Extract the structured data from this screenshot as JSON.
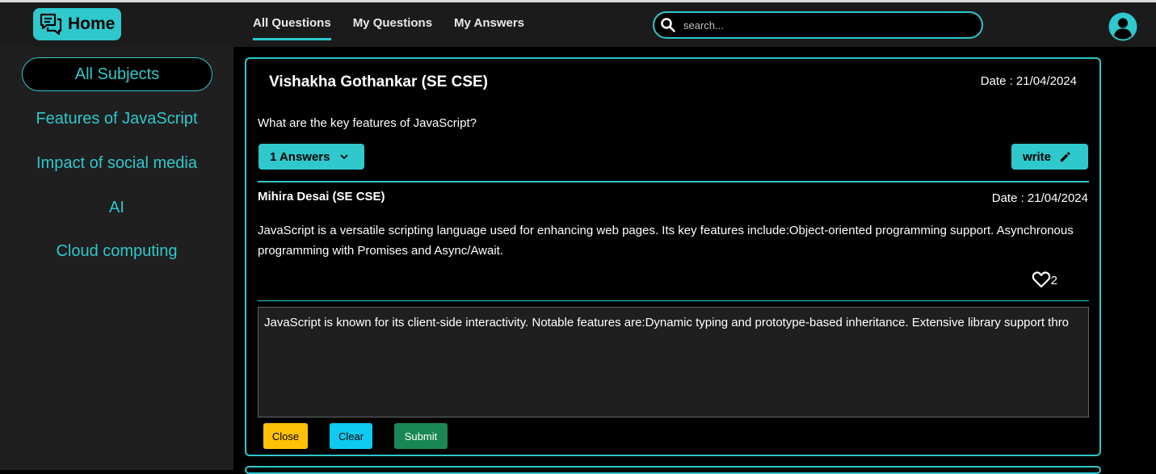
{
  "header": {
    "home_label": "Home",
    "tabs": [
      {
        "label": "All Questions",
        "active": true
      },
      {
        "label": "My Questions",
        "active": false
      },
      {
        "label": "My Answers",
        "active": false
      }
    ],
    "search_placeholder": "search..."
  },
  "sidebar": {
    "items": [
      {
        "label": "All Subjects",
        "selected": true
      },
      {
        "label": "Features of JavaScript"
      },
      {
        "label": "Impact of social media"
      },
      {
        "label": "AI"
      },
      {
        "label": "Cloud computing"
      }
    ]
  },
  "question": {
    "author": "Vishakha Gothankar (SE CSE)",
    "date": "Date : 21/04/2024",
    "text": "What are the key features of JavaScript?",
    "answers_button": "1 Answers",
    "write_button": "write"
  },
  "answer": {
    "author": "Mihira Desai (SE CSE)",
    "date": "Date : 21/04/2024",
    "text": "JavaScript is a versatile scripting language used for enhancing web pages. Its key features include:Object-oriented programming support. Asynchronous programming with Promises and Async/Await.",
    "likes": "2"
  },
  "editor": {
    "value": "JavaScript is known for its client-side interactivity. Notable features are:Dynamic typing and prototype-based inheritance. Extensive library support thro"
  },
  "buttons": {
    "close": "Close",
    "clear": "Clear",
    "submit": "Submit"
  },
  "colors": {
    "accent": "#2fc8cc",
    "close": "#ffc107",
    "clear": "#0dcaf0",
    "submit": "#198754"
  },
  "icons": [
    "chat-bubbles-icon",
    "search-icon",
    "user-avatar-icon",
    "chevron-down-icon",
    "pencil-icon",
    "heart-icon"
  ]
}
